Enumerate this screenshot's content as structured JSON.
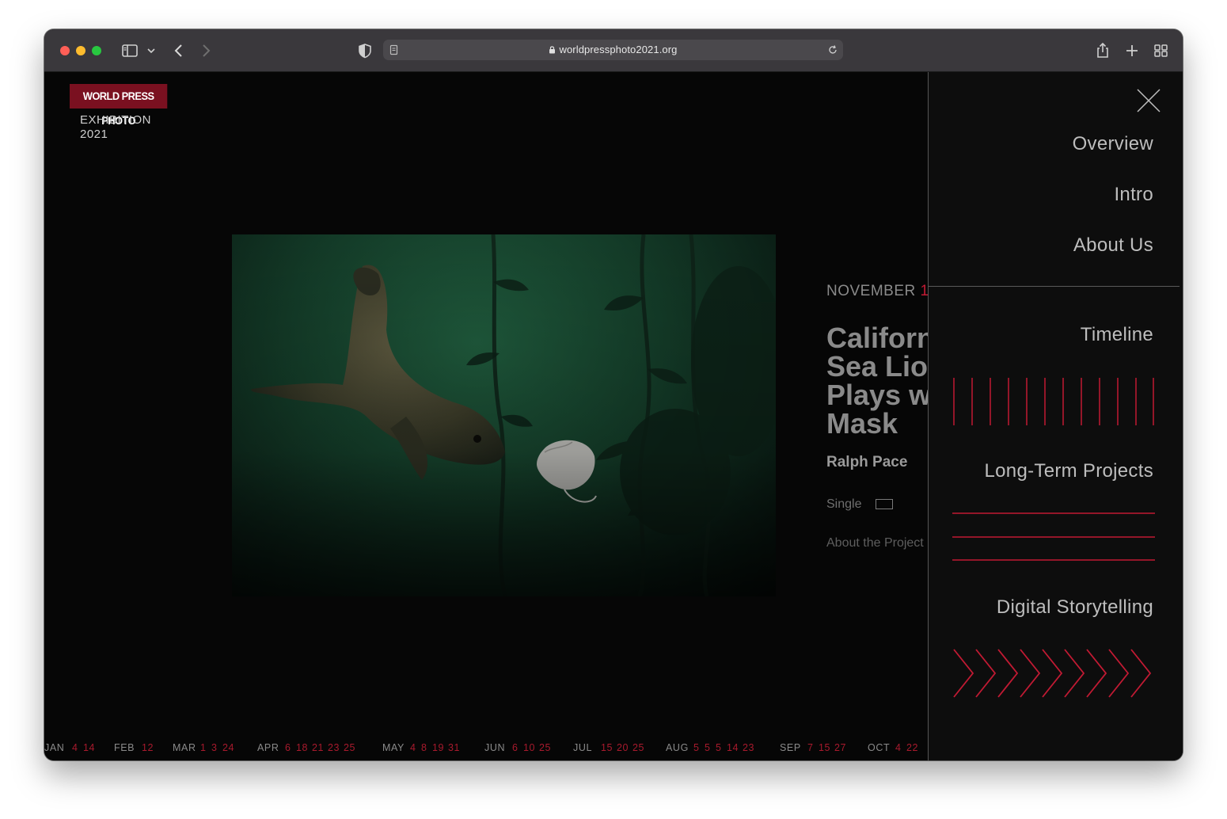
{
  "browser": {
    "url": "worldpressphoto2021.org"
  },
  "brand": {
    "logo_text": "WORLD PRESS PHOTO",
    "exhibition": "EXHIBITION",
    "year": "2021"
  },
  "story": {
    "month": "NOVEMBER",
    "day": "1",
    "title_lines": [
      "Californ",
      "Sea Lior",
      "Plays wi",
      "Mask"
    ],
    "author": "Ralph Pace",
    "type": "Single",
    "about": "About the Project"
  },
  "timeline": [
    {
      "month": "JAN",
      "days": [
        "4",
        "14"
      ]
    },
    {
      "month": "FEB",
      "days": [
        "12"
      ]
    },
    {
      "month": "MAR",
      "days": [
        "1",
        "3",
        "24"
      ]
    },
    {
      "month": "APR",
      "days": [
        "6",
        "18",
        "21",
        "23",
        "25"
      ]
    },
    {
      "month": "MAY",
      "days": [
        "4",
        "8",
        "19",
        "31"
      ]
    },
    {
      "month": "JUN",
      "days": [
        "6",
        "10",
        "25"
      ]
    },
    {
      "month": "JUL",
      "days": [
        "15",
        "20",
        "25"
      ]
    },
    {
      "month": "AUG",
      "days": [
        "5",
        "5",
        "5",
        "14",
        "23"
      ]
    },
    {
      "month": "SEP",
      "days": [
        "7",
        "15",
        "27"
      ]
    },
    {
      "month": "OCT",
      "days": [
        "4",
        "22"
      ]
    }
  ],
  "menu": {
    "overview": "Overview",
    "intro": "Intro",
    "about_us": "About Us",
    "timeline": "Timeline",
    "long_term": "Long-Term Projects",
    "digital": "Digital Storytelling"
  },
  "colors": {
    "accent": "#c21a33",
    "brand": "#7a1020"
  }
}
